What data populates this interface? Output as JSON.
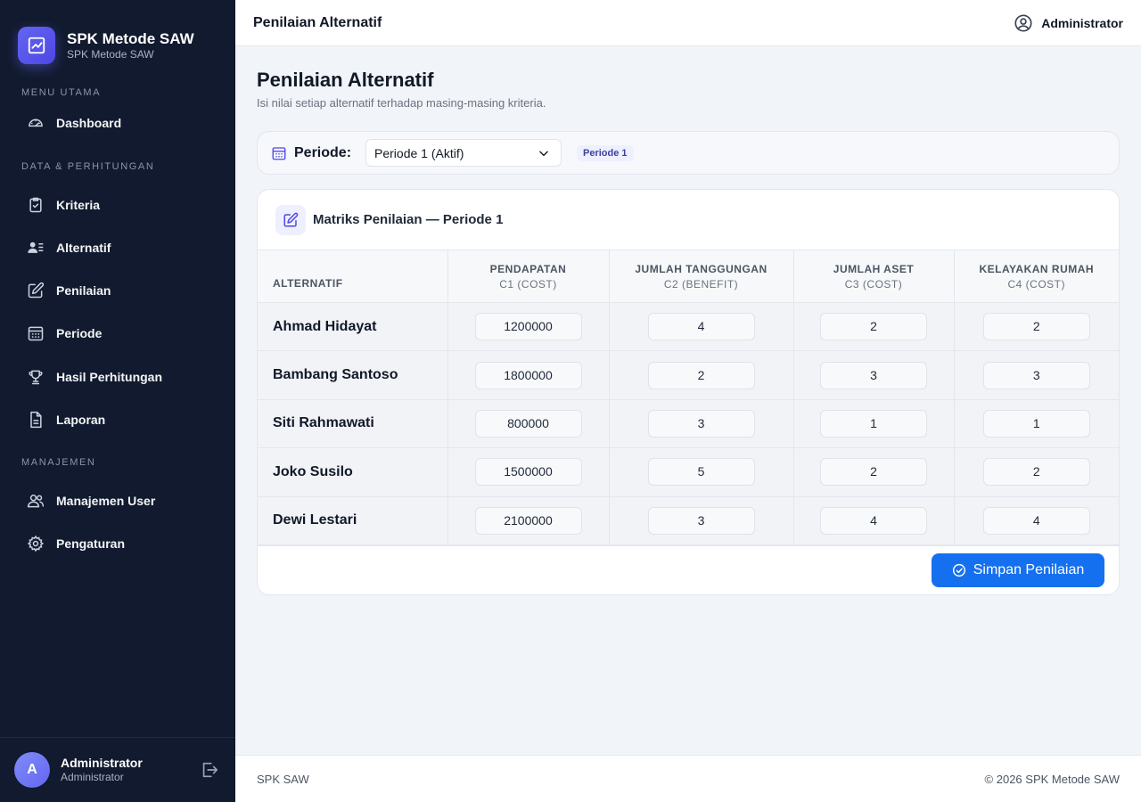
{
  "brand": {
    "title": "SPK Metode SAW",
    "subtitle": "SPK Metode SAW"
  },
  "sidebar": {
    "sections": [
      {
        "label": "MENU UTAMA"
      },
      {
        "label": "DATA & PERHITUNGAN"
      },
      {
        "label": "MANAJEMEN"
      }
    ],
    "items": [
      {
        "label": "Dashboard",
        "icon": "gauge-icon"
      },
      {
        "label": "Kriteria",
        "icon": "clipboard-check-icon"
      },
      {
        "label": "Alternatif",
        "icon": "user-list-icon"
      },
      {
        "label": "Penilaian",
        "icon": "edit-icon"
      },
      {
        "label": "Periode",
        "icon": "calendar-icon"
      },
      {
        "label": "Hasil Perhitungan",
        "icon": "trophy-icon"
      },
      {
        "label": "Laporan",
        "icon": "document-icon"
      },
      {
        "label": "Manajemen User",
        "icon": "users-icon"
      },
      {
        "label": "Pengaturan",
        "icon": "gear-icon"
      }
    ],
    "user": {
      "initial": "A",
      "name": "Administrator",
      "role": "Administrator"
    }
  },
  "header": {
    "title": "Penilaian Alternatif",
    "user": "Administrator"
  },
  "page": {
    "title": "Penilaian Alternatif",
    "subtitle": "Isi nilai setiap alternatif terhadap masing-masing kriteria."
  },
  "period": {
    "label": "Periode:",
    "selected": "Periode 1 (Aktif)",
    "badge": "Periode 1"
  },
  "matrix": {
    "title": "Matriks Penilaian — Periode 1",
    "columns": [
      {
        "label": "ALTERNATIF",
        "sub": ""
      },
      {
        "label": "PENDAPATAN",
        "sub": "C1 (COST)"
      },
      {
        "label": "JUMLAH TANGGUNGAN",
        "sub": "C2 (BENEFIT)"
      },
      {
        "label": "JUMLAH ASET",
        "sub": "C3 (COST)"
      },
      {
        "label": "KELAYAKAN RUMAH",
        "sub": "C4 (COST)"
      }
    ],
    "rows": [
      {
        "name": "Ahmad Hidayat",
        "values": [
          "1200000",
          "4",
          "2",
          "2"
        ]
      },
      {
        "name": "Bambang Santoso",
        "values": [
          "1800000",
          "2",
          "3",
          "3"
        ]
      },
      {
        "name": "Siti Rahmawati",
        "values": [
          "800000",
          "3",
          "1",
          "1"
        ]
      },
      {
        "name": "Joko Susilo",
        "values": [
          "1500000",
          "5",
          "2",
          "2"
        ]
      },
      {
        "name": "Dewi Lestari",
        "values": [
          "2100000",
          "3",
          "4",
          "4"
        ]
      }
    ],
    "save_label": "Simpan Penilaian"
  },
  "footer": {
    "left": "SPK SAW",
    "right": "© 2026 SPK Metode SAW"
  },
  "colors": {
    "sidebar": "#111a2e",
    "accent": "#6366f1",
    "primary_button": "#1570ef"
  }
}
